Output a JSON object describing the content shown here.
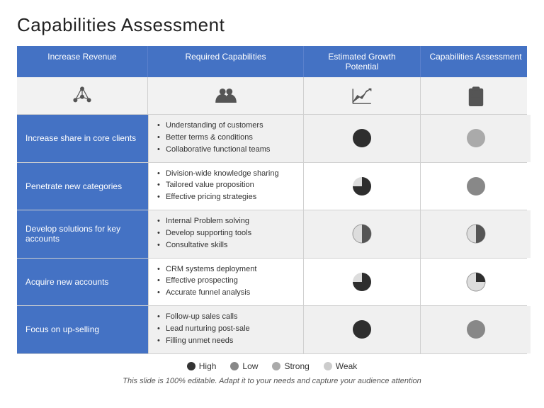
{
  "title": "Capabilities Assessment",
  "header": {
    "col1": "Increase Revenue",
    "col2": "Required Capabilities",
    "col3": "Estimated Growth Potential",
    "col4": "Capabilities Assessment"
  },
  "rows": [
    {
      "label": "Increase share in core clients",
      "bullets": [
        "Understanding of customers",
        "Better terms & conditions",
        "Collaborative functional teams"
      ],
      "growth": "full",
      "assessment": "empty"
    },
    {
      "label": "Penetrate new categories",
      "bullets": [
        "Division-wide knowledge sharing",
        "Tailored value proposition",
        "Effective pricing strategies"
      ],
      "growth": "3quarter",
      "assessment": "empty-lg"
    },
    {
      "label": "Develop solutions for key accounts",
      "bullets": [
        "Internal Problem solving",
        "Develop supporting tools",
        "Consultative skills"
      ],
      "growth": "half",
      "assessment": "half"
    },
    {
      "label": "Acquire new accounts",
      "bullets": [
        "CRM systems deployment",
        "Effective prospecting",
        "Accurate funnel analysis"
      ],
      "growth": "3quarter",
      "assessment": "quarter"
    },
    {
      "label": "Focus on up-selling",
      "bullets": [
        "Follow-up sales calls",
        "Lead nurturing post-sale",
        "Filling unmet needs"
      ],
      "growth": "full",
      "assessment": "empty-sm"
    }
  ],
  "legend": [
    {
      "label": "High",
      "color": "#333333"
    },
    {
      "label": "Low",
      "color": "#888888"
    },
    {
      "label": "Strong",
      "color": "#aaaaaa"
    },
    {
      "label": "Weak",
      "color": "#cccccc"
    }
  ],
  "footnote": "This slide is 100% editable. Adapt it to your needs and capture your audience attention"
}
